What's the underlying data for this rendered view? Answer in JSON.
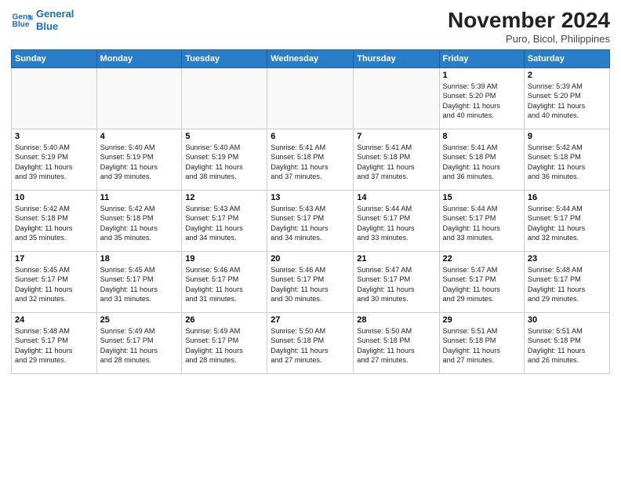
{
  "logo": {
    "line1": "General",
    "line2": "Blue"
  },
  "title": "November 2024",
  "location": "Puro, Bicol, Philippines",
  "weekdays": [
    "Sunday",
    "Monday",
    "Tuesday",
    "Wednesday",
    "Thursday",
    "Friday",
    "Saturday"
  ],
  "weeks": [
    [
      {
        "day": "",
        "info": ""
      },
      {
        "day": "",
        "info": ""
      },
      {
        "day": "",
        "info": ""
      },
      {
        "day": "",
        "info": ""
      },
      {
        "day": "",
        "info": ""
      },
      {
        "day": "1",
        "info": "Sunrise: 5:39 AM\nSunset: 5:20 PM\nDaylight: 11 hours\nand 40 minutes."
      },
      {
        "day": "2",
        "info": "Sunrise: 5:39 AM\nSunset: 5:20 PM\nDaylight: 11 hours\nand 40 minutes."
      }
    ],
    [
      {
        "day": "3",
        "info": "Sunrise: 5:40 AM\nSunset: 5:19 PM\nDaylight: 11 hours\nand 39 minutes."
      },
      {
        "day": "4",
        "info": "Sunrise: 5:40 AM\nSunset: 5:19 PM\nDaylight: 11 hours\nand 39 minutes."
      },
      {
        "day": "5",
        "info": "Sunrise: 5:40 AM\nSunset: 5:19 PM\nDaylight: 11 hours\nand 38 minutes."
      },
      {
        "day": "6",
        "info": "Sunrise: 5:41 AM\nSunset: 5:18 PM\nDaylight: 11 hours\nand 37 minutes."
      },
      {
        "day": "7",
        "info": "Sunrise: 5:41 AM\nSunset: 5:18 PM\nDaylight: 11 hours\nand 37 minutes."
      },
      {
        "day": "8",
        "info": "Sunrise: 5:41 AM\nSunset: 5:18 PM\nDaylight: 11 hours\nand 36 minutes."
      },
      {
        "day": "9",
        "info": "Sunrise: 5:42 AM\nSunset: 5:18 PM\nDaylight: 11 hours\nand 36 minutes."
      }
    ],
    [
      {
        "day": "10",
        "info": "Sunrise: 5:42 AM\nSunset: 5:18 PM\nDaylight: 11 hours\nand 35 minutes."
      },
      {
        "day": "11",
        "info": "Sunrise: 5:42 AM\nSunset: 5:18 PM\nDaylight: 11 hours\nand 35 minutes."
      },
      {
        "day": "12",
        "info": "Sunrise: 5:43 AM\nSunset: 5:17 PM\nDaylight: 11 hours\nand 34 minutes."
      },
      {
        "day": "13",
        "info": "Sunrise: 5:43 AM\nSunset: 5:17 PM\nDaylight: 11 hours\nand 34 minutes."
      },
      {
        "day": "14",
        "info": "Sunrise: 5:44 AM\nSunset: 5:17 PM\nDaylight: 11 hours\nand 33 minutes."
      },
      {
        "day": "15",
        "info": "Sunrise: 5:44 AM\nSunset: 5:17 PM\nDaylight: 11 hours\nand 33 minutes."
      },
      {
        "day": "16",
        "info": "Sunrise: 5:44 AM\nSunset: 5:17 PM\nDaylight: 11 hours\nand 32 minutes."
      }
    ],
    [
      {
        "day": "17",
        "info": "Sunrise: 5:45 AM\nSunset: 5:17 PM\nDaylight: 11 hours\nand 32 minutes."
      },
      {
        "day": "18",
        "info": "Sunrise: 5:45 AM\nSunset: 5:17 PM\nDaylight: 11 hours\nand 31 minutes."
      },
      {
        "day": "19",
        "info": "Sunrise: 5:46 AM\nSunset: 5:17 PM\nDaylight: 11 hours\nand 31 minutes."
      },
      {
        "day": "20",
        "info": "Sunrise: 5:46 AM\nSunset: 5:17 PM\nDaylight: 11 hours\nand 30 minutes."
      },
      {
        "day": "21",
        "info": "Sunrise: 5:47 AM\nSunset: 5:17 PM\nDaylight: 11 hours\nand 30 minutes."
      },
      {
        "day": "22",
        "info": "Sunrise: 5:47 AM\nSunset: 5:17 PM\nDaylight: 11 hours\nand 29 minutes."
      },
      {
        "day": "23",
        "info": "Sunrise: 5:48 AM\nSunset: 5:17 PM\nDaylight: 11 hours\nand 29 minutes."
      }
    ],
    [
      {
        "day": "24",
        "info": "Sunrise: 5:48 AM\nSunset: 5:17 PM\nDaylight: 11 hours\nand 29 minutes."
      },
      {
        "day": "25",
        "info": "Sunrise: 5:49 AM\nSunset: 5:17 PM\nDaylight: 11 hours\nand 28 minutes."
      },
      {
        "day": "26",
        "info": "Sunrise: 5:49 AM\nSunset: 5:17 PM\nDaylight: 11 hours\nand 28 minutes."
      },
      {
        "day": "27",
        "info": "Sunrise: 5:50 AM\nSunset: 5:18 PM\nDaylight: 11 hours\nand 27 minutes."
      },
      {
        "day": "28",
        "info": "Sunrise: 5:50 AM\nSunset: 5:18 PM\nDaylight: 11 hours\nand 27 minutes."
      },
      {
        "day": "29",
        "info": "Sunrise: 5:51 AM\nSunset: 5:18 PM\nDaylight: 11 hours\nand 27 minutes."
      },
      {
        "day": "30",
        "info": "Sunrise: 5:51 AM\nSunset: 5:18 PM\nDaylight: 11 hours\nand 26 minutes."
      }
    ]
  ]
}
